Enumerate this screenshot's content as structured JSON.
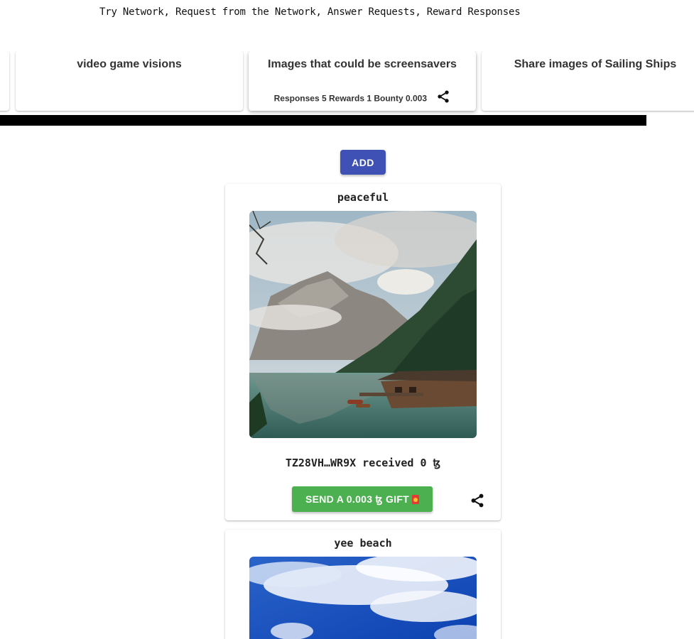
{
  "header": {
    "banner": "Try Network, Request from the Network, Answer Requests, Reward Responses"
  },
  "requests": [
    {
      "title": "video game visions"
    },
    {
      "title": "Images that could be screensavers",
      "stats": "Responses 5 Rewards 1 Bounty 0.003"
    },
    {
      "title": "Share images of Sailing Ships"
    }
  ],
  "actions": {
    "add_label": "ADD"
  },
  "responses": [
    {
      "title": "peaceful",
      "image": "mountain-lake-boathouse-photo",
      "receiver": "TZ28VH…WR9X received 0 ꜩ",
      "gift_label": "SEND A 0.003 ꜩ GIFT"
    },
    {
      "title": "yee beach",
      "image": "blue-sky-clouds-photo"
    }
  ],
  "icons": {
    "share": "share-icon",
    "gift": "red-envelope-icon"
  },
  "colors": {
    "primary": "#3f51b5",
    "success": "#4caf50"
  }
}
